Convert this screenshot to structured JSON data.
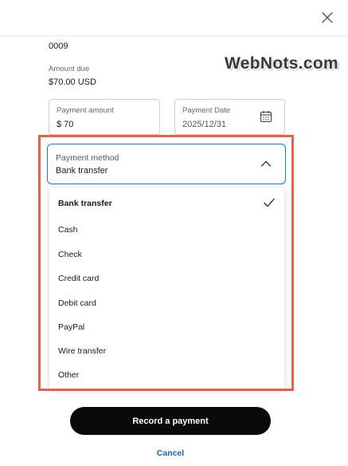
{
  "invoice": {
    "number": "0009"
  },
  "watermark": "WebNots.com",
  "amount_due": {
    "label": "Amount due",
    "value": "$70.00 USD"
  },
  "payment_amount": {
    "label": "Payment amount",
    "value": "$ 70"
  },
  "payment_date": {
    "label": "Payment Date",
    "value": "2025/12/31",
    "icon": "calendar-icon"
  },
  "payment_method": {
    "label": "Payment method",
    "value": "Bank transfer",
    "options": [
      {
        "label": "Bank transfer",
        "selected": true
      },
      {
        "label": "Cash",
        "selected": false
      },
      {
        "label": "Check",
        "selected": false
      },
      {
        "label": "Credit card",
        "selected": false
      },
      {
        "label": "Debit card",
        "selected": false
      },
      {
        "label": "PayPal",
        "selected": false
      },
      {
        "label": "Wire transfer",
        "selected": false
      },
      {
        "label": "Other",
        "selected": false
      }
    ]
  },
  "actions": {
    "record_label": "Record a payment",
    "cancel_label": "Cancel"
  },
  "colors": {
    "highlight": "#e5614f",
    "focus_border": "#1a73e8",
    "primary_button": "#0a0a0a",
    "link": "#1565c0"
  }
}
